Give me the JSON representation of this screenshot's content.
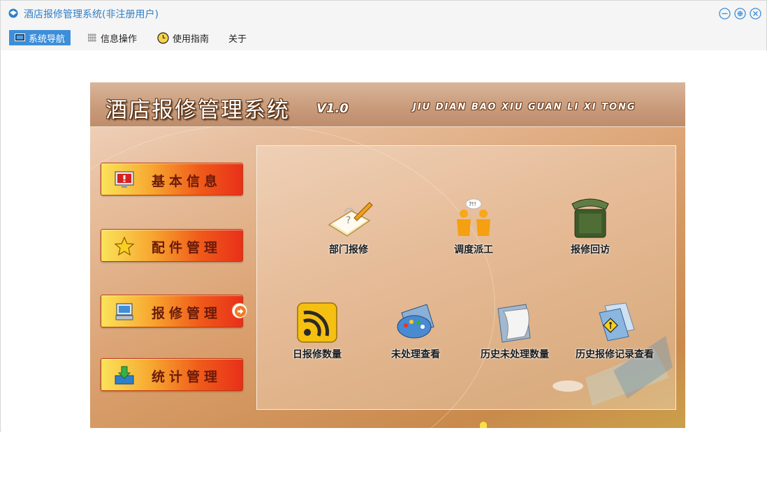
{
  "window": {
    "title": "酒店报修管理系统(非注册用户)",
    "controls": [
      "minimize-icon",
      "maximize-icon",
      "close-icon"
    ]
  },
  "menu": [
    {
      "label": "系统导航",
      "icon": "monitor-icon",
      "active": true
    },
    {
      "label": "信息操作",
      "icon": "grid-icon",
      "active": false
    },
    {
      "label": "使用指南",
      "icon": "clock-icon",
      "active": false
    },
    {
      "label": "关于",
      "icon": "",
      "active": false
    }
  ],
  "banner": {
    "title": "酒店报修管理系统",
    "version": "V1.0",
    "pinyin": "JIU DIAN BAO XIU GUAN LI XI TONG"
  },
  "nav": [
    {
      "label": "基本信息",
      "icon": "alert-monitor-icon"
    },
    {
      "label": "配件管理",
      "icon": "star-icon"
    },
    {
      "label": "报修管理",
      "icon": "computer-icon",
      "selected": true
    },
    {
      "label": "统计管理",
      "icon": "download-tray-icon"
    }
  ],
  "features": [
    {
      "label": "部门报修",
      "icon": "notepad-pencil-icon"
    },
    {
      "label": "调度派工",
      "icon": "people-talk-icon"
    },
    {
      "label": "报修回访",
      "icon": "telephone-icon"
    },
    {
      "label": "日报修数量",
      "icon": "rss-icon"
    },
    {
      "label": "未处理查看",
      "icon": "palette-icon"
    },
    {
      "label": "历史未处理数量",
      "icon": "document-scroll-icon"
    },
    {
      "label": "历史报修记录查看",
      "icon": "folder-sign-icon"
    }
  ],
  "colors": {
    "title_text": "#2f7fc8",
    "menu_active": "#3d8ed9",
    "nav_button_start": "#fbe35a",
    "nav_button_end": "#e8301a"
  }
}
